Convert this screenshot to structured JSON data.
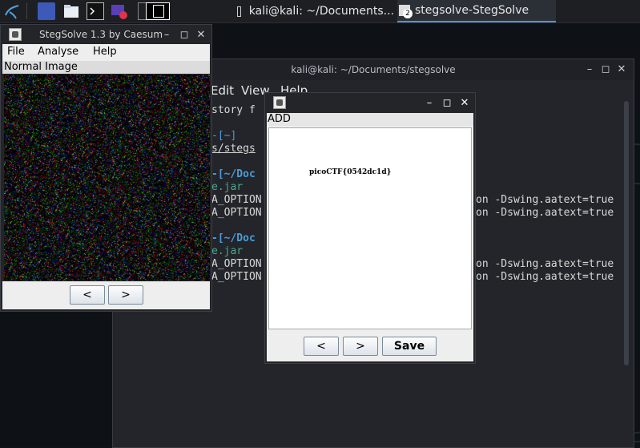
{
  "taskbar": {
    "tasks": [
      {
        "label": "kali@kali: ~/Documents..."
      },
      {
        "label": "stegsolve-StegSolve",
        "count": "2"
      }
    ]
  },
  "terminal": {
    "title": "kali@kali: ~/Documents/stegsolve",
    "menu": [
      "Edit",
      "View",
      "Help"
    ],
    "lines": [
      {
        "text": "story f"
      },
      {
        "text": "-[~]"
      },
      {
        "text": "s/stegs"
      },
      {
        "text": "-[~/Doc"
      },
      {
        "text": "e.jar"
      },
      {
        "text": "A_OPTION",
        "tail": "on -Dswing.aatext=true"
      },
      {
        "text": "A_OPTION",
        "tail": "on -Dswing.aatext=true"
      },
      {
        "text": "-[~/Doc"
      },
      {
        "text": "e.jar"
      },
      {
        "text": "A_OPTION",
        "tail": "on -Dswing.aatext=true"
      },
      {
        "text": "A_OPTION",
        "tail": "on -Dswing.aatext=true"
      }
    ]
  },
  "stegsolve": {
    "title": "StegSolve 1.3 by Caesum",
    "menu": {
      "file": "File",
      "analyse": "Analyse",
      "help": "Help"
    },
    "view_label": "Normal Image",
    "prev_label": "<",
    "next_label": ">"
  },
  "dialog": {
    "header": "ADD",
    "flag_text": "picoCTF{0542dc1d}",
    "prev_label": "<",
    "next_label": ">",
    "save_label": "Save"
  },
  "colors": {
    "panel_bg": "#1d1f23",
    "window_bg": "#232529",
    "java_gray": "#eeeeee",
    "accent": "#5c8fd6"
  }
}
